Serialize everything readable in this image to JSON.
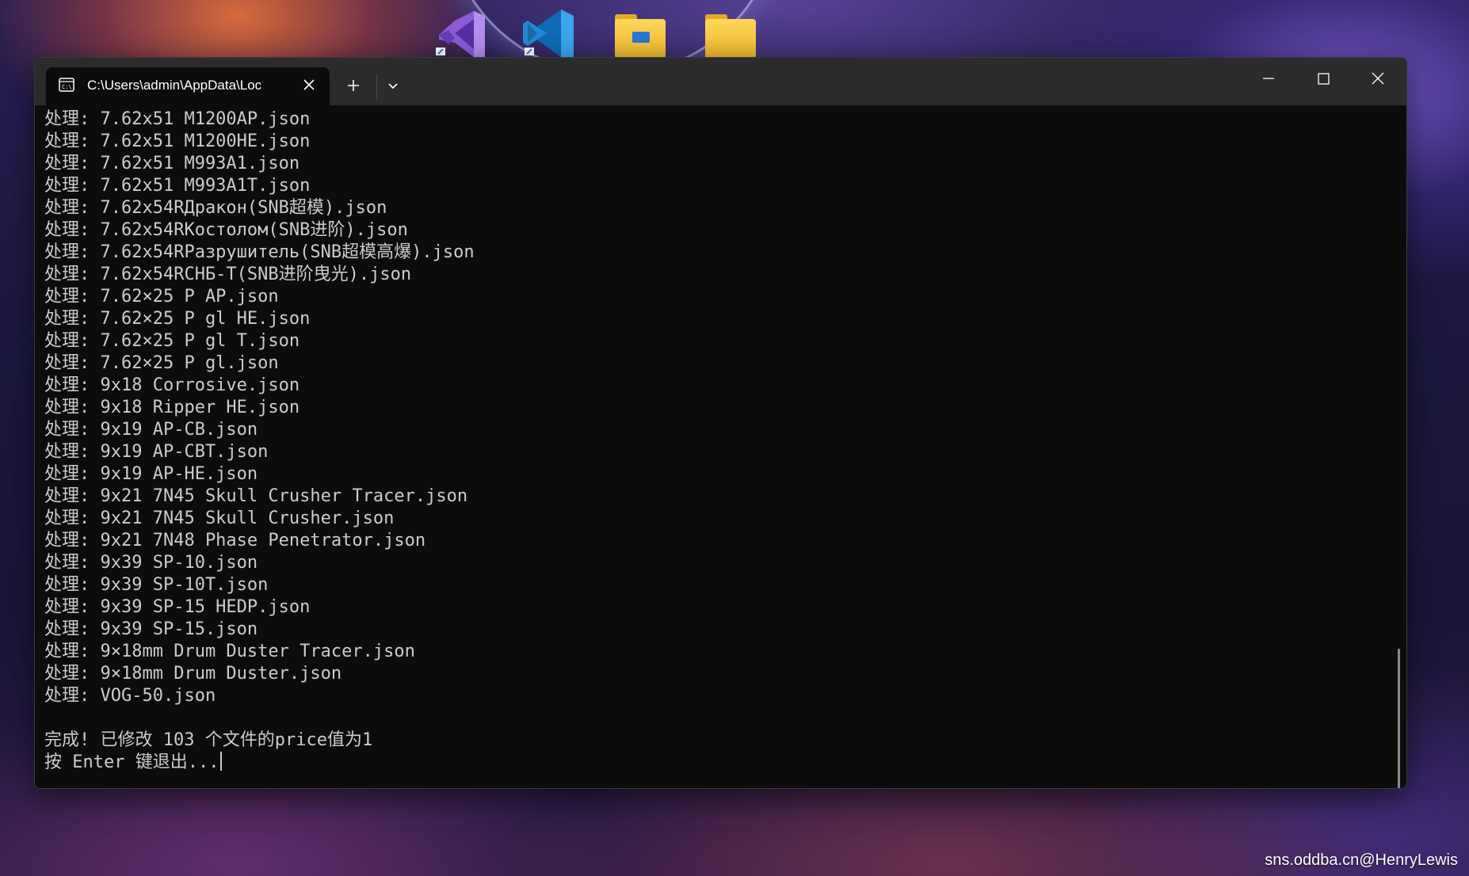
{
  "window": {
    "tab_title": "C:\\Users\\admin\\AppData\\Loc"
  },
  "terminal": {
    "lines": [
      "处理: 7.62x51 M1200AP.json",
      "处理: 7.62x51 M1200HE.json",
      "处理: 7.62x51 M993A1.json",
      "处理: 7.62x51 M993A1T.json",
      "处理: 7.62x54RДракон(SNB超模).json",
      "处理: 7.62x54RКостолом(SNB进阶).json",
      "处理: 7.62x54RРазрушитель(SNB超模高爆).json",
      "处理: 7.62x54RСНБ-Т(SNB进阶曳光).json",
      "处理: 7.62×25 P AP.json",
      "处理: 7.62×25 P gl HE.json",
      "处理: 7.62×25 P gl T.json",
      "处理: 7.62×25 P gl.json",
      "处理: 9x18 Corrosive.json",
      "处理: 9x18 Ripper HE.json",
      "处理: 9x19 AP-CB.json",
      "处理: 9x19 AP-CBT.json",
      "处理: 9x19 AP-HE.json",
      "处理: 9x21 7N45 Skull Crusher Tracer.json",
      "处理: 9x21 7N45 Skull Crusher.json",
      "处理: 9x21 7N48 Phase Penetrator.json",
      "处理: 9x39 SP-10.json",
      "处理: 9x39 SP-10T.json",
      "处理: 9x39 SP-15 HEDP.json",
      "处理: 9x39 SP-15.json",
      "处理: 9×18mm Drum Duster Tracer.json",
      "处理: 9×18mm Drum Duster.json",
      "处理: VOG-50.json"
    ],
    "done_message": "完成! 已修改 103 个文件的price值为1",
    "prompt": "按 Enter 键退出..."
  },
  "watermark": "sns.oddba.cn@HenryLewis",
  "colors": {
    "terminal_bg": "#0c0c0c",
    "terminal_text": "#cccccc",
    "titlebar_bg": "#2b2b2b"
  },
  "icons": [
    "visual-studio-icon",
    "vscode-icon",
    "file-explorer-icon",
    "folder-icon",
    "terminal-icon",
    "close-icon",
    "plus-icon",
    "chevron-down-icon",
    "minimize-icon",
    "maximize-icon"
  ]
}
